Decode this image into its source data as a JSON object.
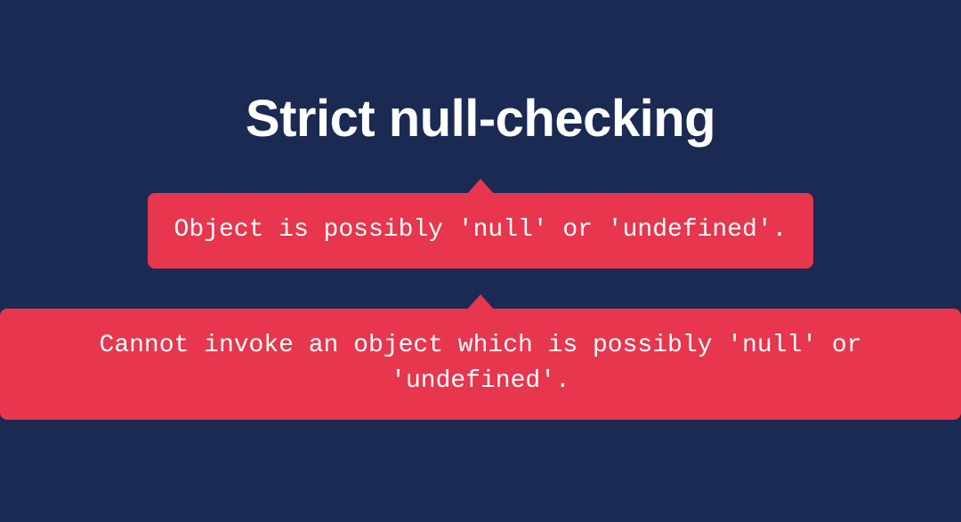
{
  "title": "Strict null-checking",
  "callouts": [
    "Object is possibly 'null' or 'undefined'.",
    "Cannot invoke an object which is possibly 'null' or 'undefined'."
  ],
  "colors": {
    "background": "#1a2a52",
    "callout": "#e7364d",
    "text": "#ffffff"
  }
}
